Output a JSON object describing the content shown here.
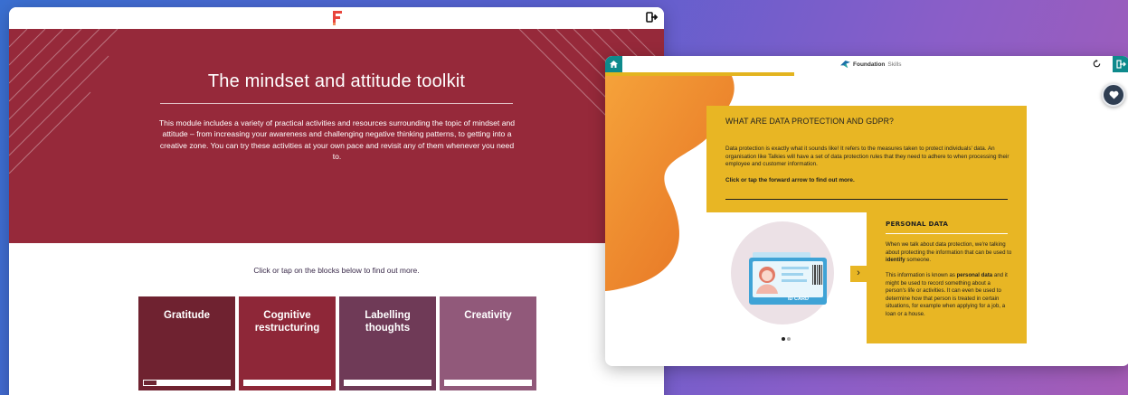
{
  "left_window": {
    "hero": {
      "title": "The mindset and attitude toolkit",
      "description": "This module includes a variety of practical activities and resources surrounding the topic of mindset and attitude – from increasing your awareness and challenging negative thinking patterns, to getting into a creative zone. You can try these activities at your own pace and revisit any of them whenever you need to."
    },
    "instruction": "Click or tap on the blocks below to find out more.",
    "blocks": [
      {
        "label_line1": "Gratitude",
        "label_line2": "",
        "color": "#6f2230",
        "progress": 0.15
      },
      {
        "label_line1": "Cognitive",
        "label_line2": "restructuring",
        "color": "#8e2738",
        "progress": 0
      },
      {
        "label_line1": "Labelling",
        "label_line2": "thoughts",
        "color": "#6f3a57",
        "progress": 0
      },
      {
        "label_line1": "Creativity",
        "label_line2": "",
        "color": "#91597a",
        "progress": 0
      }
    ],
    "hero_color": "#96293a",
    "logo_color": "#e8453c"
  },
  "right_window": {
    "brand_bold": "Foundation",
    "brand_light": "Skills",
    "progress": 0.36,
    "main_card": {
      "heading": "WHAT ARE DATA PROTECTION AND GDPR?",
      "paragraph": "Data protection is exactly what it sounds like! It refers to the measures taken to protect individuals' data. An organisation like Talkies will have a set of data protection rules that they need to adhere to when processing their employee and customer information.",
      "instruction": "Click or tap the forward arrow to find out more."
    },
    "side_card": {
      "heading": "PERSONAL DATA",
      "p1_before": "When we talk about data protection, we're talking about protecting the information that can be used to ",
      "p1_bold": "identify",
      "p1_after": " someone.",
      "p2_before": "This information is known as ",
      "p2_bold": "personal data",
      "p2_after": " and it might be used to record something about a person's life or activities. It can even be used to determine how that person is treated in certain situations, for example when applying for a job, a loan or a house."
    },
    "illustration_label": "ID CARD",
    "next_glyph": "›",
    "accent_color": "#e8b624",
    "teal_color": "#0e8a8c"
  }
}
